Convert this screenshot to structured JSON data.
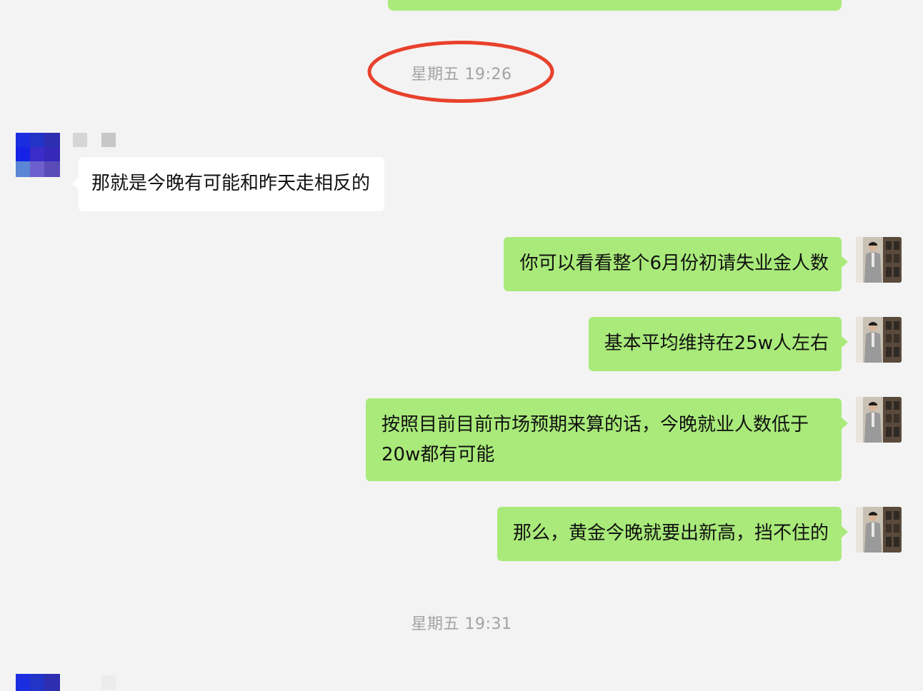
{
  "conversation": {
    "timestamps": [
      "星期五 19:26",
      "星期五 19:31"
    ],
    "incoming": [
      {
        "text": "那就是今晚有可能和昨天走相反的"
      }
    ],
    "outgoing": [
      {
        "text": "你可以看看整个6月份初请失业金人数"
      },
      {
        "text": "基本平均维持在25w人左右"
      },
      {
        "text": "按照目前目前市场预期来算的话，今晚就业人数低于20w都有可能"
      },
      {
        "text": "那么，黄金今晚就要出新高，挡不住的"
      }
    ]
  },
  "annotation": {
    "shape": "ellipse",
    "color": "#e8412c",
    "target": "星期五 19:26"
  },
  "colors": {
    "background": "#f3f3f3",
    "outgoing_bubble": "#a9ea7a",
    "incoming_bubble": "#ffffff",
    "timestamp_text": "#a3a3a3"
  }
}
